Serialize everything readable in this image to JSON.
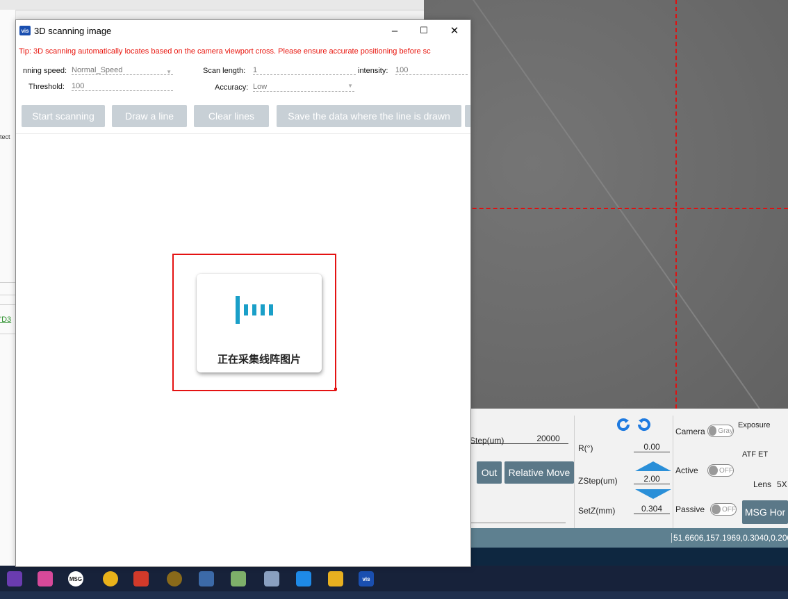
{
  "background": {
    "left_strip": {
      "text_1": "tect",
      "link_text": "'D3"
    },
    "controls": {
      "step_label": "Step(um)",
      "step_value": "20000",
      "out_button": "Out",
      "relative_move_button": "Relative Move",
      "r_label": "R(°)",
      "r_value": "0.00",
      "zstep_label": "ZStep(um)",
      "zstep_value": "2.00",
      "setz_label": "SetZ(mm)",
      "setz_value": "0.304",
      "camera_label": "Camera",
      "camera_toggle": "Gray",
      "active_label": "Active",
      "active_toggle": "OFF",
      "passive_label": "Passive",
      "passive_toggle": "OFF",
      "exposure_label": "Exposure",
      "atf_et_label": "ATF ET",
      "lens_label": "Lens",
      "lens_value": "5X",
      "msg_home_button": "MSG Hor"
    },
    "status_coords": "51.6606,157.1969,0.3040,0.200",
    "taskbar": {
      "msg_icon": "MSG",
      "vis_icon": "vis"
    }
  },
  "dialog": {
    "app_icon_text": "vis",
    "title": "3D scanning image",
    "window_controls": {
      "minimize": "–",
      "maximize": "☐",
      "close": "✕"
    },
    "tip": "Tip: 3D scanning automatically locates based on the camera viewport cross. Please ensure accurate positioning before sc",
    "fields": {
      "scanning_speed_label": "nning speed:",
      "scanning_speed_value": "Normal_Speed",
      "scan_length_label": "Scan length:",
      "scan_length_value": "1",
      "intensity_label": "intensity:",
      "intensity_value": "100",
      "threshold_label": "Threshold:",
      "threshold_value": "100",
      "accuracy_label": "Accuracy:",
      "accuracy_value": "Low"
    },
    "buttons": {
      "start_scanning": "Start scanning",
      "draw_line": "Draw a line",
      "clear_lines": "Clear lines",
      "save_data": "Save the data where the line is drawn"
    },
    "loading_text": "正在采集线阵图片"
  },
  "colors": {
    "tip_red": "#e8140c",
    "loader_accent": "#1a9fc8",
    "selection_red": "#e41212",
    "button_disabled": "#c8d0d6",
    "panel_button": "#5b7888"
  }
}
